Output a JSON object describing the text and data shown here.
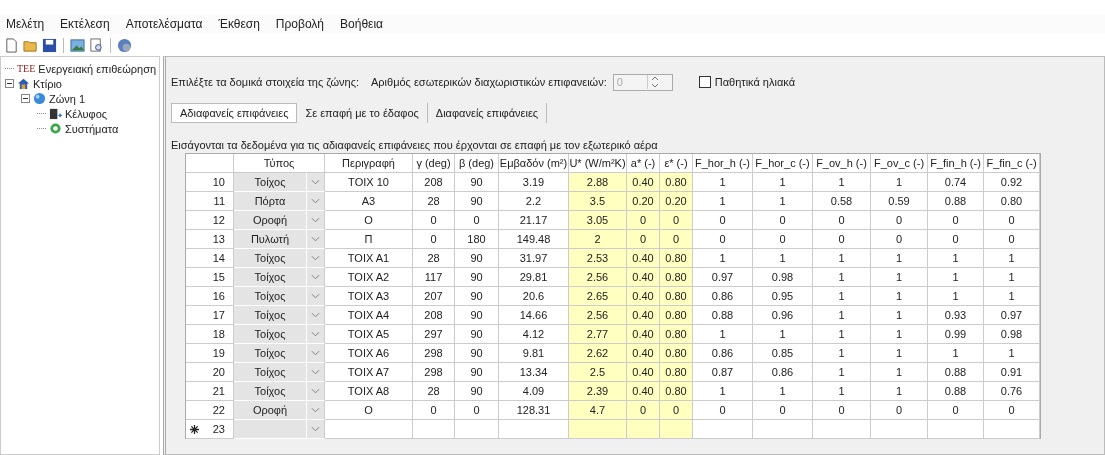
{
  "menu": [
    "Μελέτη",
    "Εκτέλεση",
    "Αποτελέσματα",
    "Έκθεση",
    "Προβολή",
    "Βοήθεια"
  ],
  "tree": [
    {
      "label": "Ενεργειακή επιθεώρηση",
      "badge": "ΤΕΕ",
      "kind": "root"
    },
    {
      "label": "Κτίριο",
      "kind": "building",
      "expanded": true,
      "children": [
        {
          "label": "Ζώνη 1",
          "kind": "zone",
          "expanded": true,
          "children": [
            {
              "label": "Κέλυφος",
              "kind": "shell"
            },
            {
              "label": "Συστήματα",
              "kind": "systems"
            }
          ]
        }
      ]
    }
  ],
  "zone_label": "Επιλέξτε τα δομικά στοιχεία της ζώνης:",
  "partitions": {
    "label": "Αριθμός εσωτερικών διαχωριστικών επιφανειών:",
    "value": "0",
    "disabled": true
  },
  "passive_solar": {
    "label": "Παθητικά ηλιακά",
    "checked": false
  },
  "tabs": [
    {
      "label": "Αδιαφανείς επιφάνειες",
      "selected": true
    },
    {
      "label": "Σε επαφή με το έδαφος",
      "selected": false
    },
    {
      "label": "Διαφανείς επιφάνειες",
      "selected": false
    }
  ],
  "caption": "Εισάγονται τα δεδομένα για τις αδιαφανείς επιφάνειες που έρχονται σε επαφή με τον εξωτερικό αέρα",
  "table": {
    "columns": [
      {
        "label": "Τύπος",
        "kind": "type"
      },
      {
        "label": "Περιγραφή",
        "kind": "text"
      },
      {
        "label": "γ (deg)",
        "kind": "text"
      },
      {
        "label": "β (deg)",
        "kind": "text"
      },
      {
        "label": "Εμβαδόν (m²)",
        "kind": "text"
      },
      {
        "label": "U* (W/m²K)",
        "kind": "input"
      },
      {
        "label": "a* (-)",
        "kind": "input"
      },
      {
        "label": "ε* (-)",
        "kind": "input"
      },
      {
        "label": "F_hor_h (-)",
        "kind": "text"
      },
      {
        "label": "F_hor_c (-)",
        "kind": "text"
      },
      {
        "label": "F_ov_h (-)",
        "kind": "text"
      },
      {
        "label": "F_ov_c (-)",
        "kind": "text"
      },
      {
        "label": "F_fin_h (-)",
        "kind": "text"
      },
      {
        "label": "F_fin_c (-)",
        "kind": "text"
      }
    ],
    "rows": [
      {
        "number": "10",
        "new": false,
        "cells": [
          "Τοίχος",
          "ΤΟΙΧ 10",
          "208",
          "90",
          "3.19",
          "2.88",
          "0.40",
          "0.80",
          "1",
          "1",
          "1",
          "1",
          "0.74",
          "0.92"
        ]
      },
      {
        "number": "11",
        "new": false,
        "cells": [
          "Πόρτα",
          "Α3",
          "28",
          "90",
          "2.2",
          "3.5",
          "0.20",
          "0.20",
          "1",
          "1",
          "0.58",
          "0.59",
          "0.88",
          "0.80"
        ]
      },
      {
        "number": "12",
        "new": false,
        "cells": [
          "Οροφή",
          "Ο",
          "0",
          "0",
          "21.17",
          "3.05",
          "0",
          "0",
          "0",
          "0",
          "0",
          "0",
          "0",
          "0"
        ]
      },
      {
        "number": "13",
        "new": false,
        "cells": [
          "Πυλωτή",
          "Π",
          "0",
          "180",
          "149.48",
          "2",
          "0",
          "0",
          "0",
          "0",
          "0",
          "0",
          "0",
          "0"
        ]
      },
      {
        "number": "14",
        "new": false,
        "cells": [
          "Τοίχος",
          "ΤΟΙΧ Α1",
          "28",
          "90",
          "31.97",
          "2.53",
          "0.40",
          "0.80",
          "1",
          "1",
          "1",
          "1",
          "1",
          "1"
        ]
      },
      {
        "number": "15",
        "new": false,
        "cells": [
          "Τοίχος",
          "ΤΟΙΧ Α2",
          "117",
          "90",
          "29.81",
          "2.56",
          "0.40",
          "0.80",
          "0.97",
          "0.98",
          "1",
          "1",
          "1",
          "1"
        ]
      },
      {
        "number": "16",
        "new": false,
        "cells": [
          "Τοίχος",
          "ΤΟΙΧ Α3",
          "207",
          "90",
          "20.6",
          "2.65",
          "0.40",
          "0.80",
          "0.86",
          "0.95",
          "1",
          "1",
          "1",
          "1"
        ]
      },
      {
        "number": "17",
        "new": false,
        "cells": [
          "Τοίχος",
          "ΤΟΙΧ Α4",
          "208",
          "90",
          "14.66",
          "2.56",
          "0.40",
          "0.80",
          "0.88",
          "0.96",
          "1",
          "1",
          "0.93",
          "0.97"
        ]
      },
      {
        "number": "18",
        "new": false,
        "cells": [
          "Τοίχος",
          "ΤΟΙΧ Α5",
          "297",
          "90",
          "4.12",
          "2.77",
          "0.40",
          "0.80",
          "1",
          "1",
          "1",
          "1",
          "0.99",
          "0.98"
        ]
      },
      {
        "number": "19",
        "new": false,
        "cells": [
          "Τοίχος",
          "ΤΟΙΧ Α6",
          "298",
          "90",
          "9.81",
          "2.62",
          "0.40",
          "0.80",
          "0.86",
          "0.85",
          "1",
          "1",
          "1",
          "1"
        ]
      },
      {
        "number": "20",
        "new": false,
        "cells": [
          "Τοίχος",
          "ΤΟΙΧ Α7",
          "298",
          "90",
          "13.34",
          "2.5",
          "0.40",
          "0.80",
          "0.87",
          "0.86",
          "1",
          "1",
          "0.88",
          "0.91"
        ]
      },
      {
        "number": "21",
        "new": false,
        "cells": [
          "Τοίχος",
          "ΤΟΙΧ Α8",
          "28",
          "90",
          "4.09",
          "2.39",
          "0.40",
          "0.80",
          "1",
          "1",
          "1",
          "1",
          "0.88",
          "0.76"
        ]
      },
      {
        "number": "22",
        "new": false,
        "cells": [
          "Οροφή",
          "Ο",
          "0",
          "0",
          "128.31",
          "4.7",
          "0",
          "0",
          "0",
          "0",
          "0",
          "0",
          "0",
          "0"
        ]
      },
      {
        "number": "23",
        "new": true,
        "cells": [
          "",
          "",
          "",
          "",
          "",
          "",
          "",
          "",
          "",
          "",
          "",
          "",
          "",
          ""
        ]
      }
    ]
  }
}
